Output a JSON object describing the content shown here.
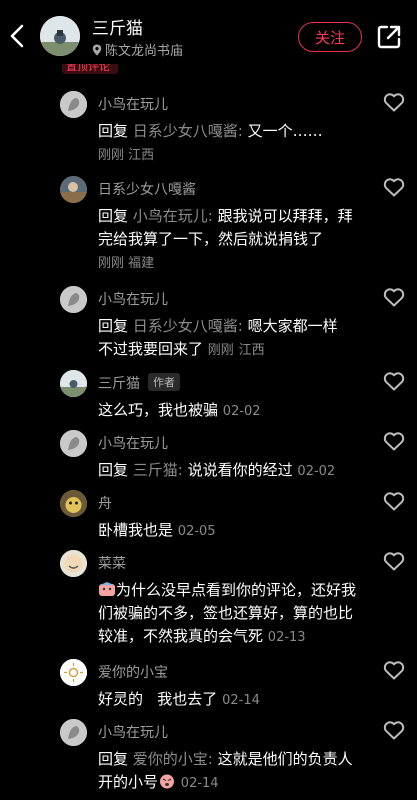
{
  "header": {
    "title": "三斤猫",
    "location": "陈文龙尚书庙",
    "follow_label": "关注"
  },
  "pinned_label": "置顶评论",
  "comments": [
    {
      "name": "小鸟在玩儿",
      "reply_kw": "回复",
      "reply_to": "日系少女八嘎酱:",
      "text": " 又一个……",
      "meta_time": "刚刚",
      "meta_loc": "江西",
      "avatar": "grey-bird"
    },
    {
      "name": "日系少女八嘎酱",
      "reply_kw": "回复",
      "reply_to": "小鸟在玩儿:",
      "text": " 跟我说可以拜拜，拜完给我算了一下，然后就说捐钱了",
      "meta_time": "刚刚",
      "meta_loc": "福建",
      "avatar": "photo"
    },
    {
      "name": "小鸟在玩儿",
      "reply_kw": "回复",
      "reply_to": "日系少女八嘎酱:",
      "text": " 嗯大家都一样不过我要回来了",
      "meta_time": "刚刚",
      "meta_loc": "江西",
      "avatar": "grey-bird"
    },
    {
      "name": "三斤猫",
      "badge": "作者",
      "text": "这么巧，我也被骗",
      "date": "02-02",
      "avatar": "sky"
    },
    {
      "name": "小鸟在玩儿",
      "reply_kw": "回复",
      "reply_to": "三斤猫:",
      "text": " 说说看你的经过",
      "date": "02-02",
      "avatar": "grey-bird"
    },
    {
      "name": "舟",
      "text": "卧槽我也是",
      "date": "02-05",
      "avatar": "cat"
    },
    {
      "name": "菜菜",
      "text": "为什么没早点看到你的评论，还好我们被骗的不多，签也还算好，算的也比较准，不然我真的会气死",
      "date": "02-13",
      "avatar": "smile"
    },
    {
      "name": "爱你的小宝",
      "text": "好灵的   我也去了",
      "date": "02-14",
      "avatar": "white"
    },
    {
      "name": "小鸟在玩儿",
      "reply_kw": "回复",
      "reply_to": "爱你的小宝:",
      "text": " 这就是他们的负责人 开的小号",
      "date": "02-14",
      "avatar": "grey-bird"
    }
  ],
  "icons": {
    "back": "chevron-left-icon",
    "location": "location-pin-icon",
    "share": "share-icon",
    "like": "heart-icon"
  },
  "colors": {
    "background": "#000000",
    "accent": "#ff3b55",
    "muted": "#8a8a8a"
  }
}
